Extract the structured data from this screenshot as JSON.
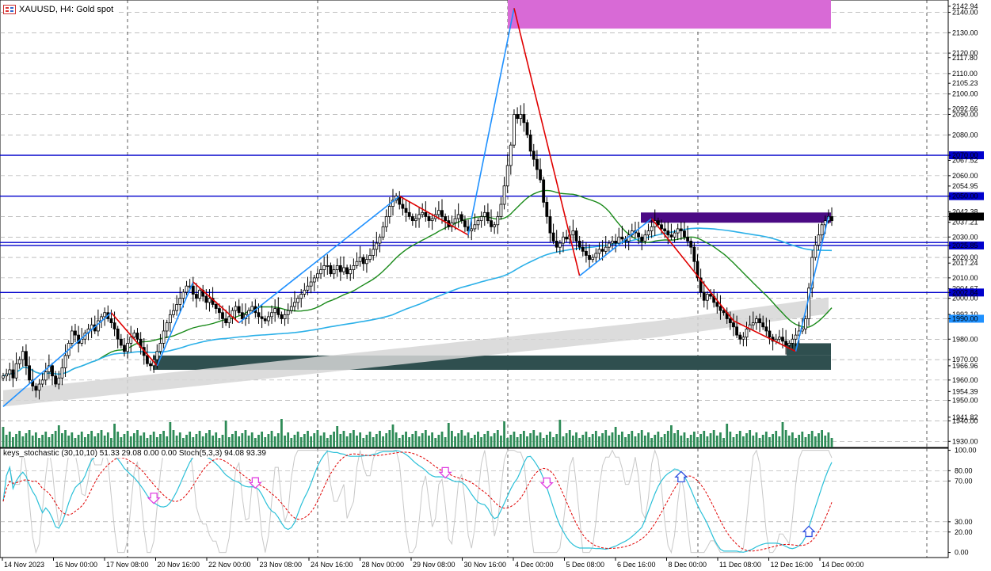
{
  "header": {
    "symbol_title": "XAUUSD, H4:  Gold spot",
    "icon": "chart-window-icon"
  },
  "indicator_label": "keys_stochastic (30,10,10) 51.33 29.08 0.00 0.00 Stoch(5,3,3) 94.08 93.39",
  "colors": {
    "bull_candle": "#ffffff",
    "bear_candle": "#000000",
    "zigzag_up": "#1e90ff",
    "zigzag_down": "#e00000",
    "ma_green": "#1a8a1a",
    "ma_blue": "#2bb0e8",
    "band_gray": "#d6d6d6",
    "resistance_zone": "#d86ad6",
    "supply_zone": "#4b0a84",
    "demand_zone": "#2f4f4f",
    "hline": "#0000cc",
    "volume": "#2e8b57",
    "stoch_main": "#2bc0d8",
    "stoch_signal": "#e00000",
    "stoch_gray": "#c8c8c8",
    "arrow_down": "#e040e0",
    "arrow_up": "#3050e0"
  },
  "price_axis": {
    "labels": [
      "2142.94",
      "2140.00",
      "2130.00",
      "2120.00",
      "2117.80",
      "2110.00",
      "2105.23",
      "2100.00",
      "2092.66",
      "2090.00",
      "2080.00",
      "2070.00",
      "2067.52",
      "2060.00",
      "2054.95",
      "2050.00",
      "2042.38",
      "2040.00",
      "2037.21",
      "2030.00",
      "2025.85",
      "2020.00",
      "2017.24",
      "2010.00",
      "2004.67",
      "2002.84",
      "2000.00",
      "1992.10",
      "1990.00",
      "1980.00",
      "1970.00",
      "1966.96",
      "1960.00",
      "1954.39",
      "1950.00",
      "1941.82",
      "1940.00",
      "1930.00"
    ],
    "highlighted": [
      {
        "text": "2070.00",
        "bg": "#0000cc"
      },
      {
        "text": "2050.00",
        "bg": "#0000cc"
      },
      {
        "text": "2040.00",
        "bg": "#000000"
      },
      {
        "text": "2025.85",
        "bg": "#0000cc"
      },
      {
        "text": "2002.84",
        "bg": "#0000cc"
      },
      {
        "text": "1990.00",
        "bg": "#1e90ff"
      }
    ]
  },
  "stoch_axis": {
    "labels": [
      "100.00",
      "80.00",
      "70.00",
      "30.00",
      "20.00",
      "0.00"
    ]
  },
  "time_axis": {
    "labels": [
      "14 Nov 2023",
      "16 Nov 00:00",
      "17 Nov 08:00",
      "20 Nov 16:00",
      "22 Nov 00:00",
      "23 Nov 08:00",
      "24 Nov 16:00",
      "28 Nov 00:00",
      "29 Nov 08:00",
      "30 Nov 16:00",
      "4 Dec 00:00",
      "5 Dec 08:00",
      "6 Dec 16:00",
      "8 Dec 00:00",
      "11 Dec 08:00",
      "12 Dec 16:00",
      "14 Dec 00:00"
    ]
  },
  "chart_data": {
    "type": "candlestick",
    "symbol": "XAUUSD",
    "timeframe": "H4",
    "ylim": [
      1927,
      2146
    ],
    "horizontal_levels": [
      2070.0,
      2050.0,
      2027.3,
      2025.85,
      2002.84
    ],
    "zones": [
      {
        "name": "resistance",
        "from": 2132,
        "to": 2146
      },
      {
        "name": "supply",
        "from": 2037,
        "to": 2042
      },
      {
        "name": "demand",
        "from": 1965,
        "to": 1972
      },
      {
        "name": "demand",
        "from": 1972,
        "to": 1978
      }
    ],
    "zigzag": [
      {
        "i": 0,
        "p": 1947
      },
      {
        "i": 33,
        "p": 1993
      },
      {
        "i": 47,
        "p": 1967
      },
      {
        "i": 58,
        "p": 2008
      },
      {
        "i": 72,
        "p": 1988
      },
      {
        "i": 121,
        "p": 2050
      },
      {
        "i": 142,
        "p": 2031
      },
      {
        "i": 156,
        "p": 2142
      },
      {
        "i": 176,
        "p": 2011
      },
      {
        "i": 198,
        "p": 2039
      },
      {
        "i": 223,
        "p": 1989
      },
      {
        "i": 242,
        "p": 1974
      },
      {
        "i": 252,
        "p": 2040
      }
    ],
    "close": [
      1962,
      1963,
      1965,
      1961,
      1968,
      1970,
      1974,
      1967,
      1960,
      1957,
      1955,
      1958,
      1960,
      1964,
      1967,
      1962,
      1958,
      1961,
      1966,
      1972,
      1978,
      1984,
      1982,
      1978,
      1980,
      1983,
      1985,
      1987,
      1984,
      1989,
      1991,
      1993,
      1990,
      1988,
      1985,
      1980,
      1977,
      1974,
      1978,
      1981,
      1983,
      1980,
      1976,
      1972,
      1968,
      1967,
      1970,
      1974,
      1978,
      1984,
      1988,
      1992,
      1994,
      1997,
      2000,
      2003,
      2006,
      2006,
      2002,
      2000,
      2004,
      2001,
      1998,
      2000,
      1997,
      1995,
      1993,
      1990,
      1988,
      1991,
      1994,
      1996,
      1993,
      1990,
      1992,
      1994,
      1996,
      1993,
      1991,
      1990,
      1989,
      1991,
      1993,
      1995,
      1992,
      1990,
      1992,
      1994,
      1996,
      1998,
      2000,
      2002,
      2004,
      2006,
      2008,
      2010,
      2012,
      2014,
      2016,
      2016,
      2012,
      2014,
      2016,
      2013,
      2015,
      2012,
      2014,
      2016,
      2018,
      2020,
      2017,
      2019,
      2021,
      2024,
      2027,
      2030,
      2035,
      2040,
      2045,
      2048,
      2050,
      2046,
      2044,
      2042,
      2040,
      2038,
      2039,
      2041,
      2042,
      2040,
      2038,
      2039,
      2041,
      2043,
      2040,
      2038,
      2035,
      2037,
      2039,
      2041,
      2038,
      2035,
      2033,
      2034,
      2036,
      2038,
      2040,
      2042,
      2038,
      2035,
      2036,
      2040,
      2046,
      2055,
      2065,
      2075,
      2090,
      2088,
      2090,
      2086,
      2080,
      2072,
      2068,
      2063,
      2058,
      2047,
      2040,
      2032,
      2028,
      2025,
      2027,
      2030,
      2029,
      2031,
      2033,
      2028,
      2025,
      2023,
      2021,
      2019,
      2020,
      2022,
      2024,
      2023,
      2025,
      2027,
      2028,
      2027,
      2030,
      2029,
      2028,
      2031,
      2033,
      2032,
      2030,
      2028,
      2031,
      2033,
      2035,
      2038,
      2036,
      2034,
      2033,
      2031,
      2030,
      2032,
      2034,
      2033,
      2030,
      2028,
      2025,
      2018,
      2010,
      2003,
      1999,
      2002,
      2001,
      1998,
      1996,
      1994,
      1993,
      1990,
      1988,
      1986,
      1982,
      1980,
      1981,
      1985,
      1987,
      1988,
      1990,
      1988,
      1986,
      1984,
      1981,
      1979,
      1980,
      1981,
      1979,
      1977,
      1978,
      1980,
      1982,
      1984,
      1985,
      1990,
      2005,
      2020,
      2026,
      2031,
      2036,
      2038,
      2040,
      2038
    ]
  },
  "stoch_data": {
    "ylim": [
      -5,
      102
    ],
    "levels": [
      80,
      70,
      30,
      20
    ],
    "arrows_down_at": [
      46,
      77,
      135,
      166
    ],
    "arrows_up_at": [
      207,
      246
    ]
  }
}
